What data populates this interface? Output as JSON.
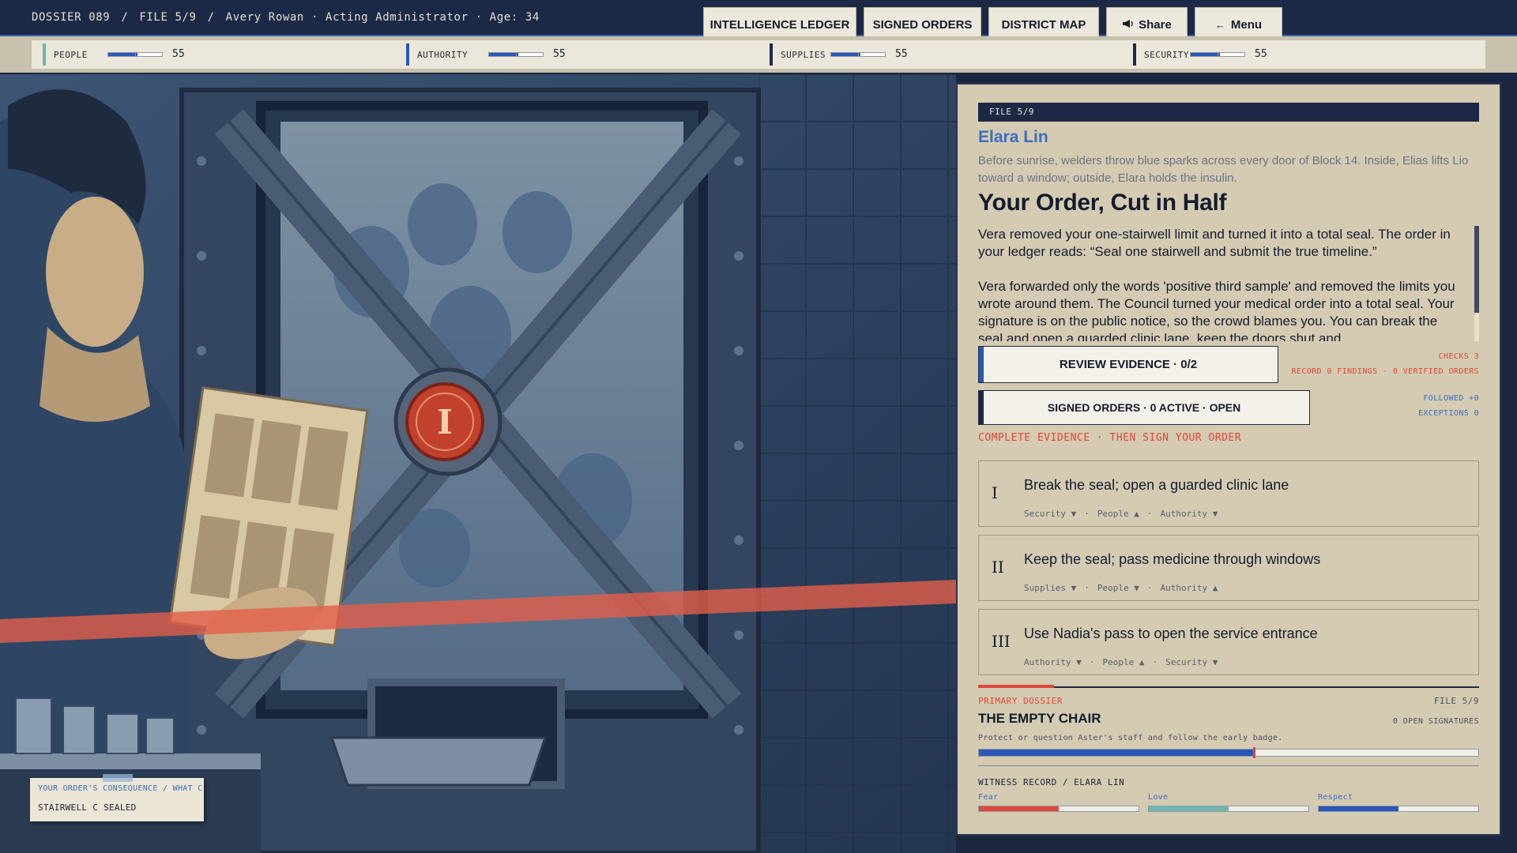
{
  "breadcrumb": {
    "dossier": "DOSSIER 089",
    "file": "FILE 5/9",
    "player": "Avery Rowan · Acting Administrator · Age: 34",
    "separator": "/"
  },
  "nav": {
    "ledger": "INTELLIGENCE LEDGER",
    "orders": "SIGNED ORDERS",
    "map": "DISTRICT MAP",
    "share": "Share",
    "share_icon": "megaphone-icon",
    "menu": "Menu",
    "menu_icon": "arrow-left-icon"
  },
  "stats": {
    "scale_max": 100,
    "items": [
      {
        "label": "PEOPLE",
        "value": 55,
        "color": "#6fb6b0"
      },
      {
        "label": "AUTHORITY",
        "value": 55,
        "color": "#2a57b8"
      },
      {
        "label": "SUPPLIES",
        "value": 55,
        "color": "#1d2845"
      },
      {
        "label": "SECURITY",
        "value": 55,
        "color": "#1d2845"
      }
    ]
  },
  "scene": {
    "stamp_line1": "YOUR ORDER'S CONSEQUENCE / WHAT C",
    "stamp_line2": "STAIRWELL C SEALED",
    "seal_numeral": "I"
  },
  "panel": {
    "file_header": "FILE 5/9",
    "character": "Elara Lin",
    "intro": "Before sunrise, welders throw blue sparks across every door of Block 14. Inside, Elias lifts Lio toward a window; outside, Elara holds the insulin.",
    "title": "Your Order, Cut in Half",
    "body_p1": "Vera removed your one-stairwell limit and turned it into a total seal. The order in your ledger reads: “Seal one stairwell and submit the true timeline.”",
    "body_p2": "Vera forwarded only the words 'positive third sample' and removed the limits you wrote around them. The Council turned your medical order into a total seal. Your signature is on the public notice, so the crowd blames you. You can break the seal and open a guarded clinic lane, keep the doors shut and",
    "scroll_position": 0,
    "review_button": "REVIEW EVIDENCE · 0/2",
    "orders_button": "SIGNED ORDERS · 0 ACTIVE · OPEN",
    "checks": "CHECKS 3",
    "record": "RECORD 0 FINDINGS · 0 VERIFIED ORDERS",
    "followed": "FOLLOWED +0",
    "exceptions": "EXCEPTIONS 0",
    "hint": "COMPLETE EVIDENCE · THEN SIGN YOUR ORDER",
    "choices": [
      {
        "numeral": "I",
        "text": "Break the seal; open a guarded clinic lane",
        "effects": [
          "Security ▼",
          "People ▲",
          "Authority ▼"
        ]
      },
      {
        "numeral": "II",
        "text": "Keep the seal; pass medicine through windows",
        "effects": [
          "Supplies ▼",
          "People ▼",
          "Authority ▲"
        ]
      },
      {
        "numeral": "III",
        "text": "Use Nadia's pass to open the service entrance",
        "effects": [
          "Authority ▼",
          "People ▲",
          "Security ▼"
        ]
      }
    ],
    "effect_separator": "·",
    "primary": {
      "label": "PRIMARY DOSSIER",
      "file": "FILE 5/9",
      "title": "THE EMPTY CHAIR",
      "signatures": "0 OPEN SIGNATURES",
      "desc": "Protect or question Aster's staff and follow the early badge.",
      "progress": 0.55
    },
    "witness": {
      "label": "WITNESS RECORD / ELARA LIN",
      "bars": [
        {
          "label": "Fear",
          "value": 0.5,
          "color": "#e0473a"
        },
        {
          "label": "Love",
          "value": 0.5,
          "color": "#6fb6b0"
        },
        {
          "label": "Respect",
          "value": 0.5,
          "color": "#2a57b8"
        }
      ]
    }
  }
}
